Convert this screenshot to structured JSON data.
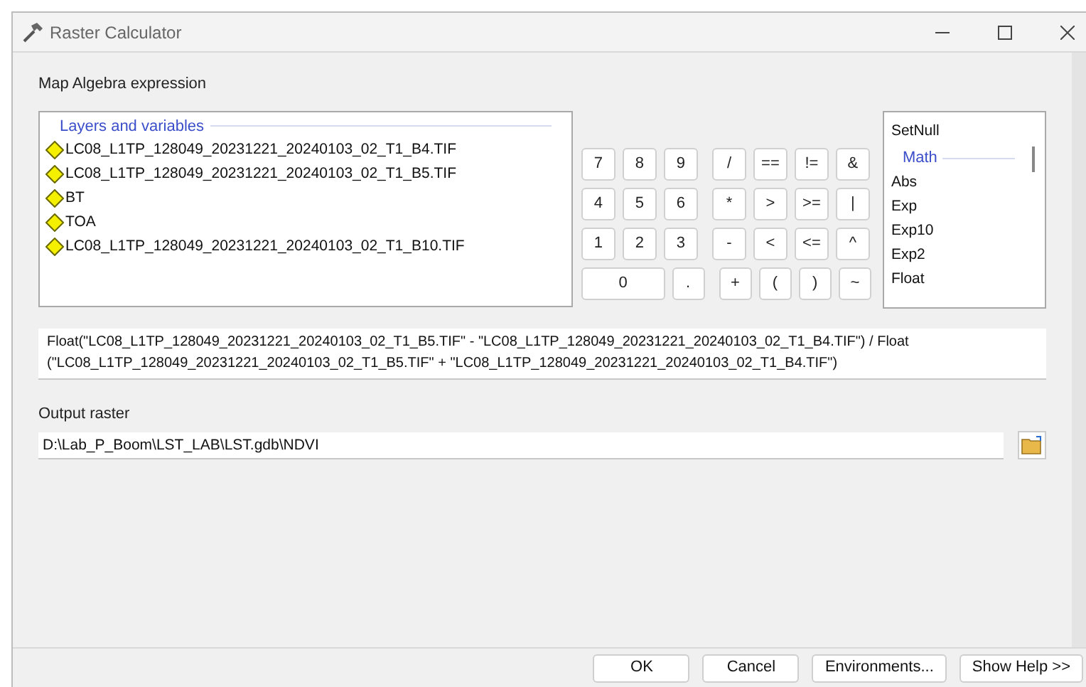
{
  "window": {
    "title": "Raster Calculator"
  },
  "expression_label": "Map Algebra expression",
  "layers": {
    "title": "Layers and variables",
    "items": [
      {
        "label": "LC08_L1TP_128049_20231221_20240103_02_T1_B4.TIF"
      },
      {
        "label": "LC08_L1TP_128049_20231221_20240103_02_T1_B5.TIF"
      },
      {
        "label": "BT"
      },
      {
        "label": "TOA"
      },
      {
        "label": "LC08_L1TP_128049_20231221_20240103_02_T1_B10.TIF"
      }
    ]
  },
  "keypad": [
    [
      "7",
      "8",
      "9",
      "/",
      "==",
      "!=",
      "&"
    ],
    [
      "4",
      "5",
      "6",
      "*",
      ">",
      ">=",
      "|"
    ],
    [
      "1",
      "2",
      "3",
      "-",
      "<",
      "<=",
      "^"
    ],
    [
      "0",
      ".",
      "+",
      "(",
      ")",
      "~"
    ]
  ],
  "functions": [
    {
      "kind": "item",
      "label": "SetNull"
    },
    {
      "kind": "header",
      "label": "Math"
    },
    {
      "kind": "item",
      "label": "Abs"
    },
    {
      "kind": "item",
      "label": "Exp"
    },
    {
      "kind": "item",
      "label": "Exp10"
    },
    {
      "kind": "item",
      "label": "Exp2"
    },
    {
      "kind": "item",
      "label": "Float"
    }
  ],
  "expression": "Float(\"LC08_L1TP_128049_20231221_20240103_02_T1_B5.TIF\" - \"LC08_L1TP_128049_20231221_20240103_02_T1_B4.TIF\") / Float (\"LC08_L1TP_128049_20231221_20240103_02_T1_B5.TIF\" + \"LC08_L1TP_128049_20231221_20240103_02_T1_B4.TIF\")",
  "output": {
    "label": "Output raster",
    "value": "D:\\Lab_P_Boom\\LST_LAB\\LST.gdb\\NDVI"
  },
  "buttons": [
    "OK",
    "Cancel",
    "Environments...",
    "Show Help >>"
  ]
}
